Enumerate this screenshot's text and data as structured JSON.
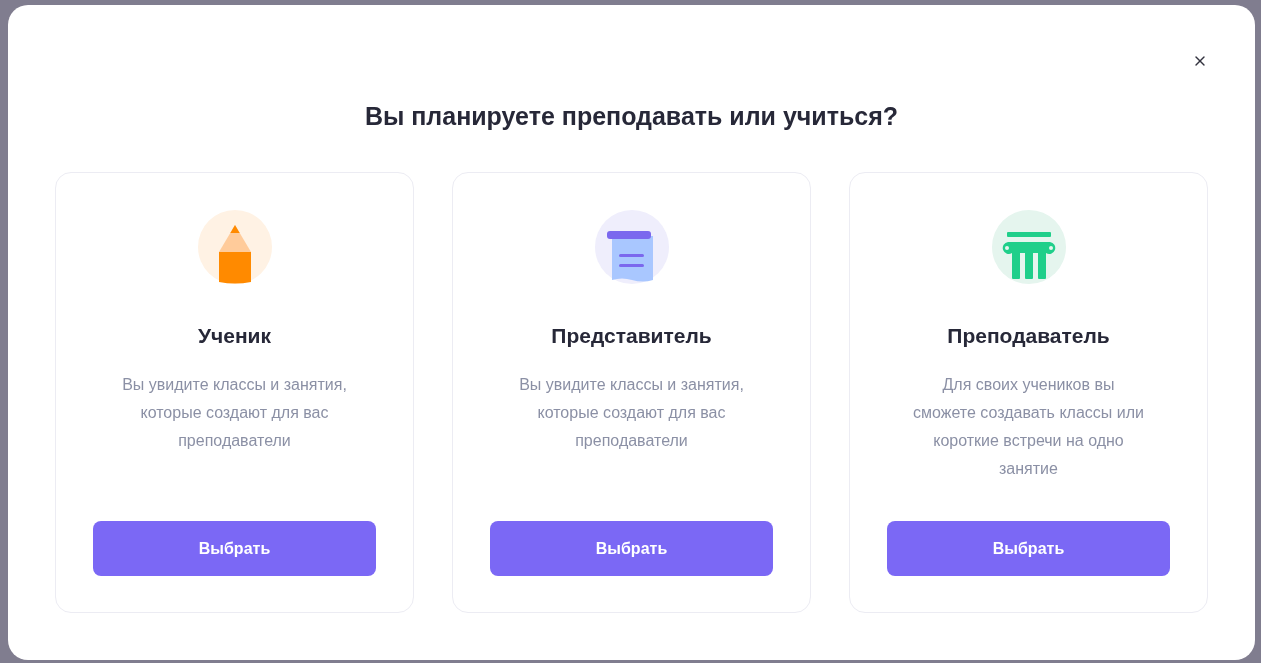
{
  "dialog": {
    "title": "Вы планируете преподавать или учиться?",
    "options": [
      {
        "title": "Ученик",
        "description_lines": [
          "Вы увидите классы и занятия,",
          "которые создают для вас",
          "преподаватели"
        ],
        "button": "Выбрать"
      },
      {
        "title": "Представитель",
        "description_lines": [
          "Вы увидите классы и занятия,",
          "которые создают для вас",
          "преподаватели"
        ],
        "button": "Выбрать"
      },
      {
        "title": "Преподаватель",
        "description_lines": [
          "Для своих учеников вы",
          "сможете создавать классы или",
          "короткие встречи на одно",
          "занятие"
        ],
        "button": "Выбрать"
      }
    ]
  }
}
